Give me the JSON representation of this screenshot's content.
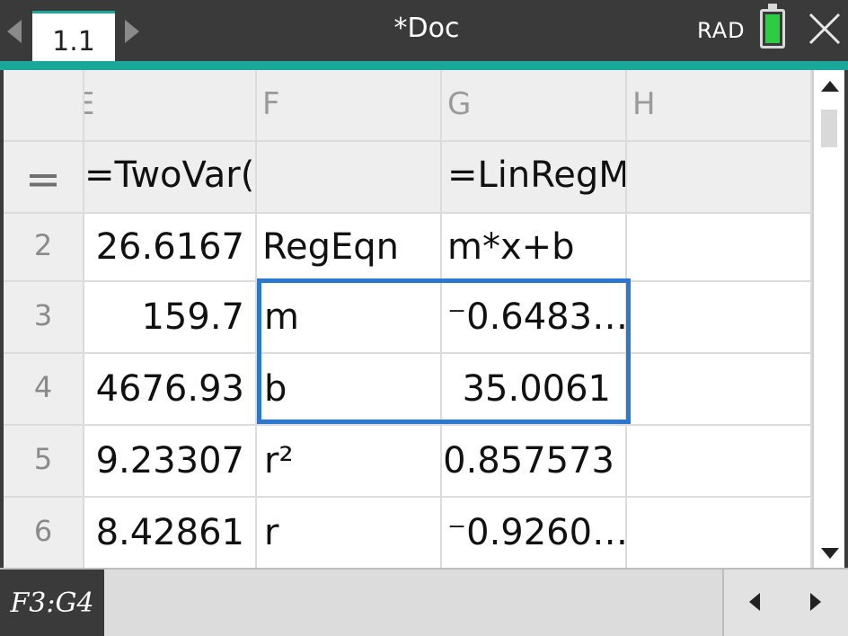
{
  "header": {
    "tab_label": "1.1",
    "doc_title": "*Doc",
    "angle_mode": "RAD",
    "icons": [
      "left-arrow-icon",
      "right-arrow-icon",
      "battery-icon",
      "close-icon"
    ],
    "colors": {
      "accent": "#1aa89a",
      "battery": "#2ecc40",
      "selection": "#2a78d2"
    }
  },
  "sheet": {
    "columns": [
      "E",
      "F",
      "G",
      "H"
    ],
    "formula_row": {
      "indicator": "=",
      "E": "=TwoVar(",
      "F": "",
      "G": "=LinRegM",
      "H": ""
    },
    "rows": [
      {
        "num": "2",
        "E": "26.6167",
        "F": "RegEqn",
        "G": "m*x+b",
        "H": ""
      },
      {
        "num": "3",
        "E": "159.7",
        "F": "m",
        "G": "⁻0.6483…",
        "H": ""
      },
      {
        "num": "4",
        "E": "4676.93",
        "F": "b",
        "G": "35.0061",
        "H": ""
      },
      {
        "num": "5",
        "E": "9.23307",
        "F": "r²",
        "G": "0.857573",
        "H": ""
      },
      {
        "num": "6",
        "E": "8.42861",
        "F": "r",
        "G": "⁻0.9260…",
        "H": ""
      }
    ],
    "selection": "F3:G4"
  },
  "footer": {
    "cell_reference": "F3:G4",
    "entry_value": ""
  }
}
